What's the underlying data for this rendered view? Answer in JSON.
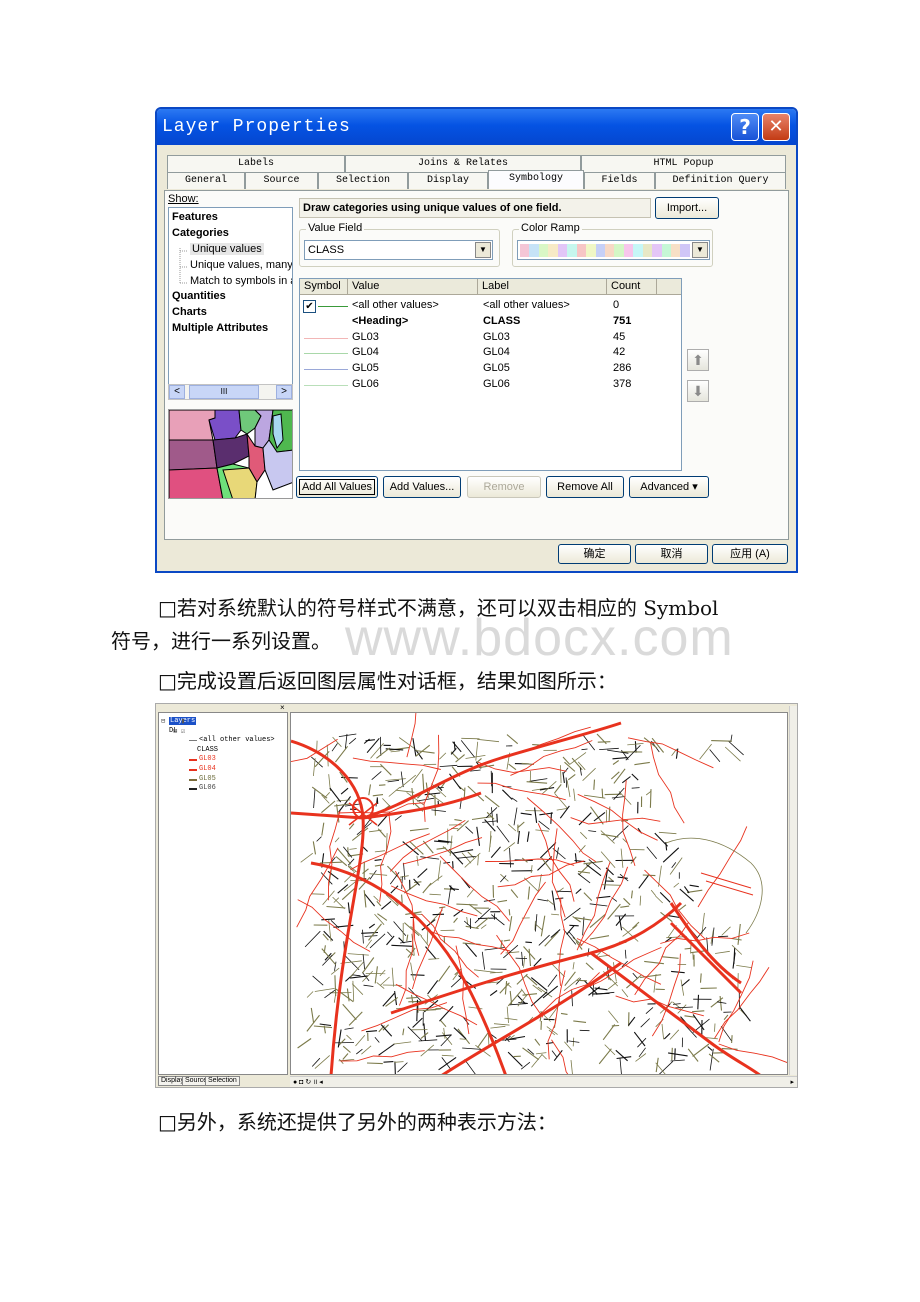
{
  "dialog": {
    "title": "Layer Properties",
    "help_icon": "?",
    "close_icon": "✕",
    "tabs_row1": [
      "Labels",
      "Joins & Relates",
      "HTML Popup"
    ],
    "tabs_row2": [
      "General",
      "Source",
      "Selection",
      "Display",
      "Symbology",
      "Fields",
      "Definition Query"
    ],
    "active_tab": "Symbology",
    "show_label": "Show:",
    "show_items": [
      {
        "label": "Features",
        "bold": true
      },
      {
        "label": "Categories",
        "bold": true
      },
      {
        "label": "Unique values",
        "bold": false,
        "selected": true
      },
      {
        "label": "Unique values, many f",
        "bold": false
      },
      {
        "label": "Match to symbols in a",
        "bold": false
      },
      {
        "label": "Quantities",
        "bold": true
      },
      {
        "label": "Charts",
        "bold": true
      },
      {
        "label": "Multiple Attributes",
        "bold": true
      }
    ],
    "scroll_left_icon": "<",
    "scroll_right_icon": ">",
    "scroll_thumb": "III",
    "description": "Draw categories using unique values of one field.",
    "import_button": "Import...",
    "value_field_label": "Value Field",
    "value_field_value": "CLASS",
    "color_ramp_label": "Color Ramp",
    "color_ramp_colors": [
      "#f4c6d6",
      "#c6e3f7",
      "#d9f7c6",
      "#f7eac6",
      "#e2c6f7",
      "#c6f7ee",
      "#f7c6c6",
      "#f0f7c6",
      "#c6d0f7",
      "#f7d9c6",
      "#d4f7c6",
      "#f7c6ec",
      "#c6f7f7",
      "#e8e8c6",
      "#e4c6f7",
      "#c6f7d6",
      "#f7e0c6",
      "#d0c6f7"
    ],
    "table_headers": [
      "Symbol",
      "Value",
      "Label",
      "Count"
    ],
    "table_rows": [
      {
        "value": "<all other values>",
        "label": "<all other values>",
        "count": "0",
        "color": "#3a9a3a",
        "checkbox": true,
        "bold": false
      },
      {
        "value": "<Heading>",
        "label": "CLASS",
        "count": "751",
        "color": "",
        "checkbox": false,
        "bold": true
      },
      {
        "value": "GL03",
        "label": "GL03",
        "count": "45",
        "color": "#f2b6b6",
        "checkbox": false,
        "bold": false
      },
      {
        "value": "GL04",
        "label": "GL04",
        "count": "42",
        "color": "#a9d8a9",
        "checkbox": false,
        "bold": false
      },
      {
        "value": "GL05",
        "label": "GL05",
        "count": "286",
        "color": "#9aa8d8",
        "checkbox": false,
        "bold": false
      },
      {
        "value": "GL06",
        "label": "GL06",
        "count": "378",
        "color": "#b9dfb9",
        "checkbox": false,
        "bold": false
      }
    ],
    "check_mark": "✔",
    "move_up_icon": "⬆",
    "move_down_icon": "⬇",
    "buttons": {
      "add_all": "Add All Values",
      "add": "Add Values...",
      "remove": "Remove",
      "remove_all": "Remove All",
      "advanced": "Advanced ▾"
    },
    "footer": {
      "ok": "确定",
      "cancel": "取消",
      "apply": "应用 (A)"
    }
  },
  "document": {
    "para1_line1": "□若对系统默认的符号样式不满意，还可以双击相应的 Symbol",
    "para1_line2": "符号，进行一系列设置。",
    "para2": "□完成设置后返回图层属性对话框，结果如图所示：",
    "para3": "□另外，系统还提供了另外的两种表示方法：",
    "watermark": "www.bdocx.com"
  },
  "arcmap": {
    "toc_items": [
      {
        "label": "Layers",
        "highlight": true
      },
      {
        "label": "DL"
      },
      {
        "label": "<all other values>",
        "swatch": "#7a7a7a"
      },
      {
        "label": "CLASS"
      },
      {
        "label": "GL03",
        "swatch": "#e8321e",
        "color": "#e8321e"
      },
      {
        "label": "GL04",
        "swatch": "#e8321e",
        "color": "#e8321e"
      },
      {
        "label": "GL05",
        "swatch": "#7b6b3a",
        "color": "#6b6b3a"
      },
      {
        "label": "GL06",
        "swatch": "#222222",
        "color": "#444444"
      }
    ],
    "toc_tabs": [
      "Display",
      "Source",
      "Selection"
    ],
    "close_icon": "×",
    "status_icons": "● ◘ ↻ ॥ ◂",
    "status_right": "▸",
    "road_colors": {
      "major": "#e8321e",
      "minor": "#7b7a4a",
      "local": "#111111"
    }
  }
}
